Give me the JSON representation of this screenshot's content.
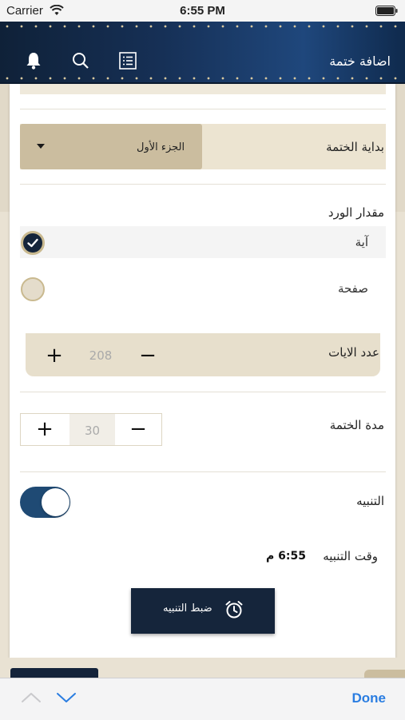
{
  "status_bar": {
    "carrier": "Carrier",
    "time": "6:55 PM"
  },
  "header": {
    "title": "اضافة ختمة",
    "icons": [
      "bell-icon",
      "search-icon",
      "list-icon"
    ]
  },
  "form": {
    "start": {
      "label": "بداية الختمة",
      "value": "الجزء الأول"
    },
    "wird": {
      "title": "مقدار الورد",
      "options": [
        {
          "label": "آية",
          "selected": true
        },
        {
          "label": "صفحة",
          "selected": false
        }
      ]
    },
    "verses_count": {
      "label": "عدد الايات",
      "value": "208",
      "plus": "+",
      "minus": "−"
    },
    "duration": {
      "label": "مدة الختمة",
      "value": "30",
      "plus": "+",
      "minus": "−"
    },
    "alarm": {
      "label": "التنبيه",
      "enabled": true
    },
    "alarm_time": {
      "label": "وقت التنبيه",
      "value": "6:55 م"
    },
    "set_alarm_button": "ضبط التنبيه"
  },
  "keyboard_toolbar": {
    "done": "Done"
  },
  "colors": {
    "navy": "#15253b",
    "cream": "#ece4d1",
    "tan": "#cbbd9f",
    "toggle_on": "#1f4a74",
    "done_blue": "#2a7de1"
  }
}
